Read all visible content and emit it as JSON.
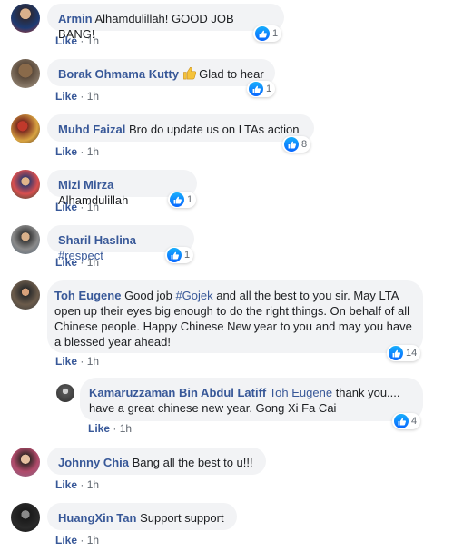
{
  "comments": [
    {
      "name": "Armin",
      "text": "Alhamdulillah! GOOD JOB BANG!",
      "reactions": "1",
      "like": "Like",
      "dot": "·",
      "time": "1h"
    },
    {
      "name": "Borak Ohmama Kutty",
      "emoji": "thumbs-up",
      "text": "Glad to hear",
      "reactions": "1",
      "like": "Like",
      "dot": "·",
      "time": "1h"
    },
    {
      "name": "Muhd Faizal",
      "text": "Bro do update us on LTAs action",
      "reactions": "8",
      "like": "Like",
      "dot": "·",
      "time": "1h"
    },
    {
      "name": "Mizi Mirza",
      "text": "Alhamdulillah",
      "reactions": "1",
      "like": "Like",
      "dot": "·",
      "time": "1h"
    },
    {
      "name": "Sharil Haslina",
      "tag": "#respect",
      "reactions": "1",
      "like": "Like",
      "dot": "·",
      "time": "1h"
    },
    {
      "name": "Toh Eugene",
      "text_pre": "Good job",
      "tag": "#Gojek",
      "text": "and all the best to you sir. May LTA open up their eyes big enough to do the right things. On behalf of all Chinese people. Happy Chinese New year to you and may you have a blessed year ahead!",
      "reactions": "14",
      "like": "Like",
      "dot": "·",
      "time": "1h"
    },
    {
      "name": "Kamaruzzaman Bin Abdul Latiff",
      "mention": "Toh Eugene",
      "text": "thank you.... have a great chinese new year. Gong Xi Fa Cai",
      "reactions": "4",
      "like": "Like",
      "dot": "·",
      "time": "1h"
    },
    {
      "name": "Johnny Chia",
      "text": "Bang all the best to u!!!",
      "like": "Like",
      "dot": "·",
      "time": "1h"
    },
    {
      "name": "HuangXin Tan",
      "text": "Support support",
      "like": "Like",
      "dot": "·",
      "time": "1h"
    }
  ],
  "colors": {
    "name": "#385898",
    "bubble": "#f2f3f5",
    "like_blue": "#0866ff",
    "meta": "#606770"
  },
  "icons": {
    "reaction": "like-reaction-icon",
    "emoji": "thumbs-up-emoji-icon"
  }
}
